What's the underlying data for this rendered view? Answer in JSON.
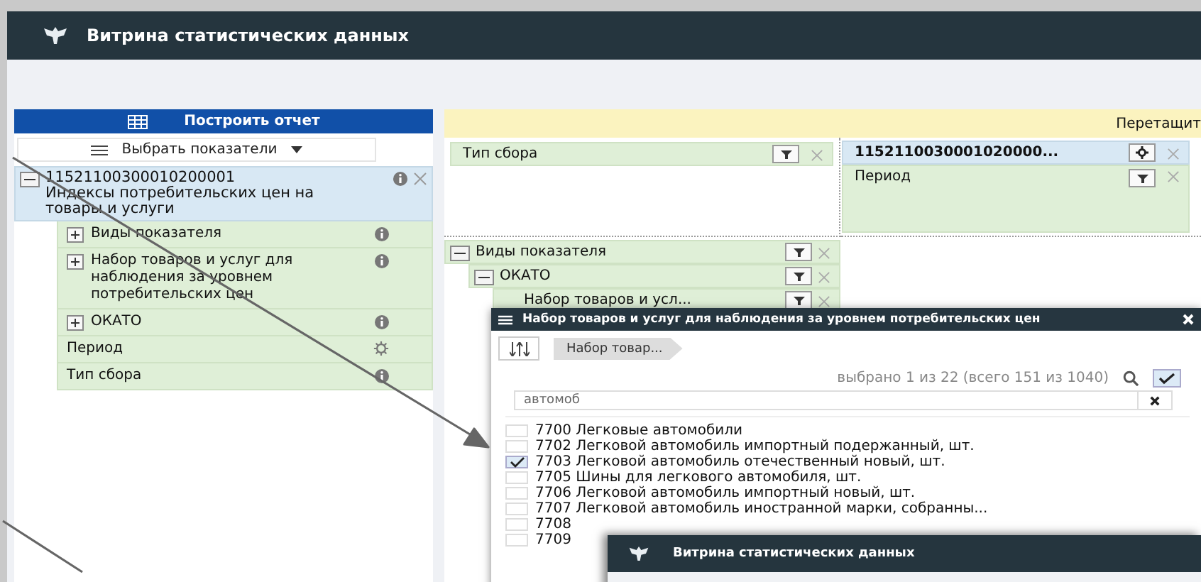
{
  "header": {
    "title": "Витрина статистических данных"
  },
  "left_panel": {
    "build_button": "Построить отчет",
    "select_button": "Выбрать показатели",
    "indicator": {
      "code": "11521100300010200001",
      "name": "Индексы потребительских цен на товары и услуги",
      "expanded": true,
      "items": [
        {
          "label": "Виды показателя",
          "kind": "group"
        },
        {
          "label": "Набор товаров и услуг для наблюдения за уровнем потребительских цен",
          "kind": "group"
        },
        {
          "label": "ОКАТО",
          "kind": "group"
        },
        {
          "label": "Период",
          "kind": "time"
        },
        {
          "label": "Тип сбора",
          "kind": "attribute"
        }
      ]
    }
  },
  "pivot": {
    "banner": "Перетащит",
    "filters": [
      {
        "label": "Тип сбора"
      }
    ],
    "columns": [
      {
        "label": "1152110030001020000...",
        "kind": "indicator"
      },
      {
        "label": "Период",
        "kind": "dimension"
      }
    ],
    "rows": [
      {
        "label": "Виды показателя",
        "expanded": true,
        "children": [
          {
            "label": "ОКАТО",
            "expanded": true,
            "children": [
              {
                "label": "Набор товаров и усл..."
              }
            ]
          }
        ]
      }
    ]
  },
  "dialog": {
    "title": "Набор товаров и услуг для наблюдения за уровнем потребительских цен",
    "breadcrumb": "Набор товар...",
    "count": "выбрано 1 из 22 (всего 151 из 1040)",
    "select_all": {
      "checked": true
    },
    "search": {
      "value": "автомоб"
    },
    "items": [
      {
        "label": "7700 Легковые автомобили",
        "checked": false
      },
      {
        "label": "7702 Легковой автомобиль импортный подержанный, шт.",
        "checked": false
      },
      {
        "label": "7703 Легковой автомобиль отечественный новый, шт.",
        "checked": true
      },
      {
        "label": "7705 Шины для легкового автомобиля, шт.",
        "checked": false
      },
      {
        "label": "7706 Легковой автомобиль импортный новый, шт.",
        "checked": false
      },
      {
        "label": "7707 Легковой автомобиль иностранной марки, собранны...",
        "checked": false
      },
      {
        "label": "7708",
        "checked": false
      },
      {
        "label": "7709",
        "checked": false
      }
    ]
  },
  "inset": {
    "title": "Витрина статистических данных"
  }
}
